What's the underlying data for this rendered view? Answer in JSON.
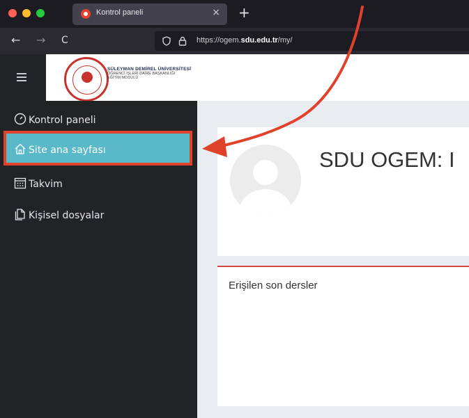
{
  "browser": {
    "tab_title": "Kontrol paneli",
    "tab_close": "×",
    "new_tab": "+",
    "url_prefix": "https://ogem.",
    "url_domain": "sdu.edu.tr",
    "url_path": "/my/",
    "back": "←",
    "forward": "→",
    "reload": "C"
  },
  "header": {
    "logo_line1": "SÜLEYMAN DEMİREL ÜNİVERSİTESİ",
    "logo_line2": "ÖĞRENCİ İŞLERİ DAİRE BAŞKANLIĞI",
    "logo_line3": "EĞİTİM MODÜLÜ"
  },
  "sidebar": {
    "items": [
      {
        "label": "Kontrol paneli",
        "icon": "dashboard-icon"
      },
      {
        "label": "Site ana sayfası",
        "icon": "home-icon"
      },
      {
        "label": "Takvim",
        "icon": "calendar-icon"
      },
      {
        "label": "Kişisel dosyalar",
        "icon": "files-icon"
      }
    ]
  },
  "main": {
    "page_title": "SDU OGEM: I",
    "recent_courses_title": "Erişilen son dersler"
  },
  "colors": {
    "accent_highlight": "#5ab9c9",
    "annotation_red": "#e0412b",
    "sidebar_bg": "#212327"
  }
}
